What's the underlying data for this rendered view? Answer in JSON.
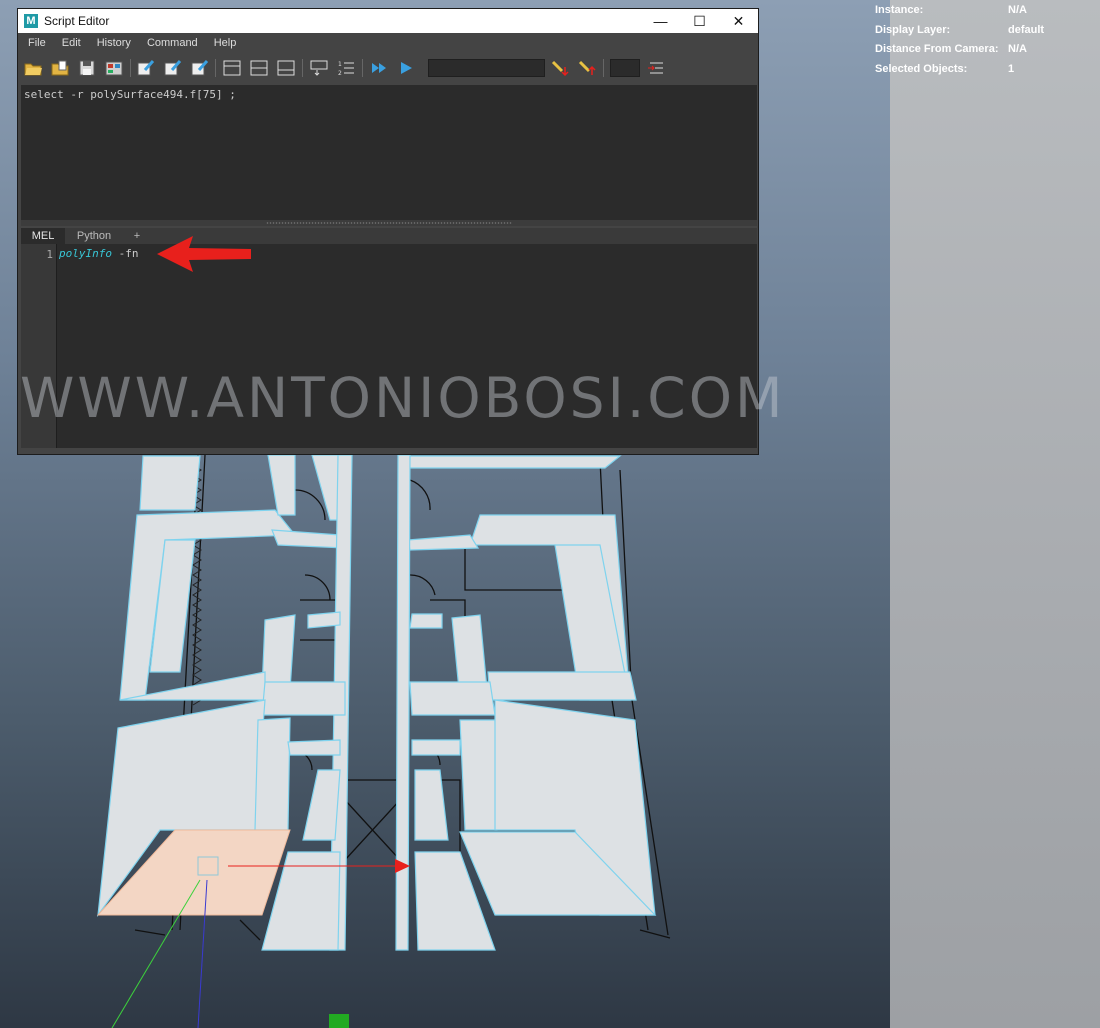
{
  "hud": {
    "rows": [
      {
        "label": "Instance:",
        "value": "N/A"
      },
      {
        "label": "Display Layer:",
        "value": "default"
      },
      {
        "label": "Distance From Camera:",
        "value": "N/A"
      },
      {
        "label": "Selected Objects:",
        "value": "1"
      }
    ]
  },
  "script_editor": {
    "title": "Script Editor",
    "logo": "M",
    "window_controls": {
      "minimize": "—",
      "maximize": "☐",
      "close": "✕"
    },
    "menu": [
      "File",
      "Edit",
      "History",
      "Command",
      "Help"
    ],
    "output_text": "select -r polySurface494.f[75] ;",
    "tabs": [
      "MEL",
      "Python",
      "+"
    ],
    "active_tab": "MEL",
    "editor": {
      "line_number": "1",
      "command": "polyInfo",
      "flag": " -fn"
    }
  },
  "watermark": "WWW.ANTONIOBOSI.COM",
  "colors": {
    "annotation_arrow": "#e8201c",
    "selection": "#f3d6c4",
    "mesh_edge": "#7fd3ee"
  }
}
